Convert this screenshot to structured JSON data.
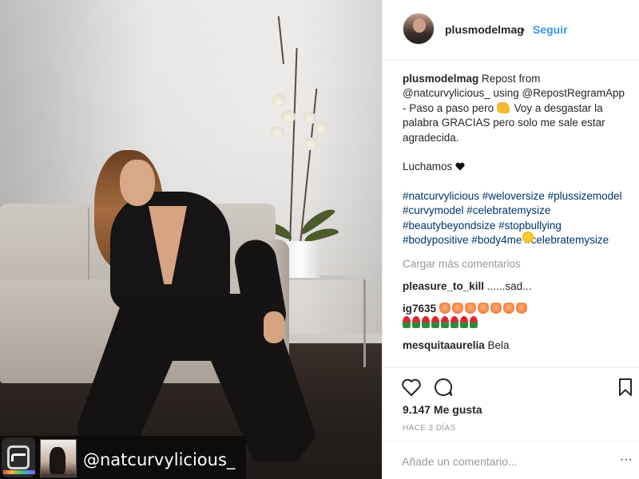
{
  "photo": {
    "repost_handle": "@natcurvylicious_"
  },
  "header": {
    "username": "plusmodelmag",
    "separator": "•",
    "follow_label": "Seguir"
  },
  "caption": {
    "username": "plusmodelmag",
    "text_part1": " Repost from @natcurvylicious_ using @RepostRegramApp - Paso a paso pero ",
    "text_part2": " Voy a desgastar la palabra GRACIAS pero solo me sale estar agradecida.\n\nLuchamos ",
    "hashtags": "#natcurvylicious #weloversize #plussizemodel #curvymodel #celebratemysize #beautybeyondsize #stopbullying #bodypositive #body4me #celebratemysize"
  },
  "load_more_label": "Cargar más comentarios",
  "comments": [
    {
      "user": "pleasure_to_kill",
      "text": " ......sad..."
    },
    {
      "user": "ig7635",
      "text": " "
    },
    {
      "user": "mesquitaaurelia",
      "text": " Bela"
    }
  ],
  "likes_text": "9.147 Me gusta",
  "time_text": "HACE 3 DÍAS",
  "add_comment": {
    "placeholder": "Añade un comentario..."
  },
  "more_label": "···",
  "icons": [
    "heart-icon",
    "comment-icon",
    "bookmark-icon",
    "muscle-emoji",
    "black-heart-emoji"
  ],
  "colors": {
    "link_blue": "#3897f0",
    "hashtag": "#003569",
    "muted": "#999999",
    "border": "#efefef"
  }
}
